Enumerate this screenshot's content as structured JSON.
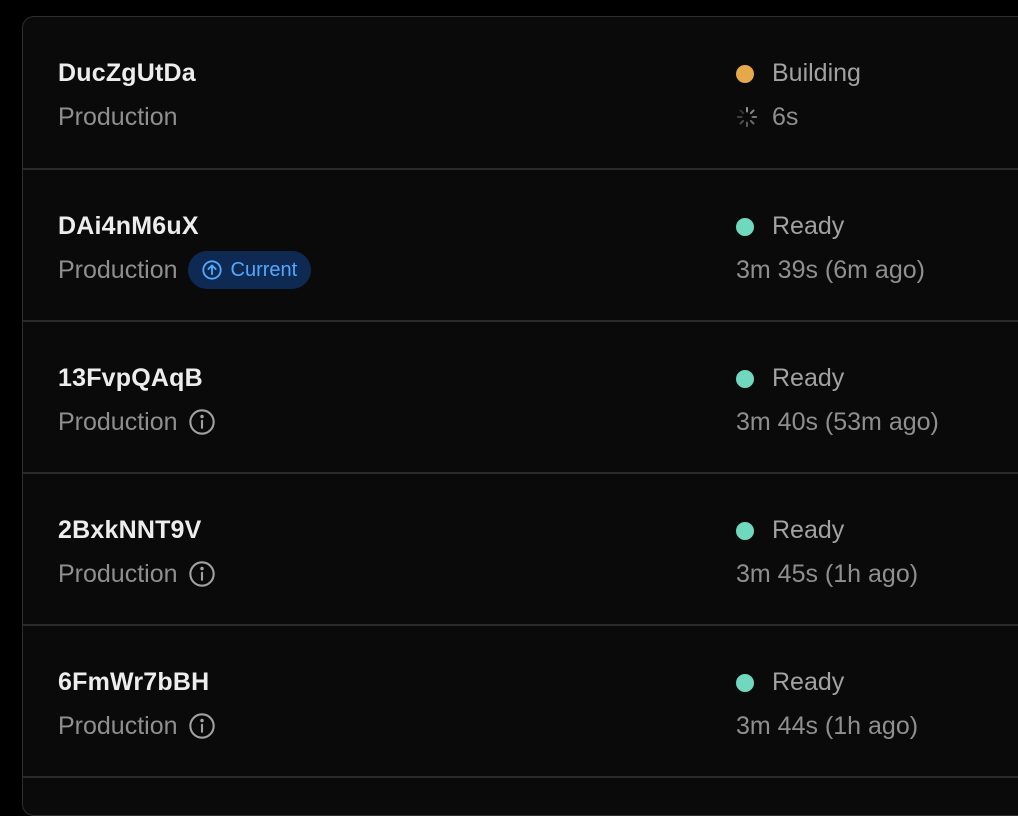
{
  "colors": {
    "building": "#e5a84b",
    "ready": "#6fd8bf",
    "badge_bg": "#0f2a52",
    "badge_text": "#52a8ff"
  },
  "deployments": [
    {
      "id": "DucZgUtDa",
      "environment": "Production",
      "status": "Building",
      "status_icon": "spinner-icon",
      "duration": "6s"
    },
    {
      "id": "DAi4nM6uX",
      "environment": "Production",
      "badge": "Current",
      "badge_icon": "arrow-up-circle-icon",
      "status": "Ready",
      "duration": "3m 39s (6m ago)"
    },
    {
      "id": "13FvpQAqB",
      "environment": "Production",
      "env_icon": "info-icon",
      "status": "Ready",
      "duration": "3m 40s (53m ago)"
    },
    {
      "id": "2BxkNNT9V",
      "environment": "Production",
      "env_icon": "info-icon",
      "status": "Ready",
      "duration": "3m 45s (1h ago)"
    },
    {
      "id": "6FmWr7bBH",
      "environment": "Production",
      "env_icon": "info-icon",
      "status": "Ready",
      "duration": "3m 44s (1h ago)"
    }
  ]
}
